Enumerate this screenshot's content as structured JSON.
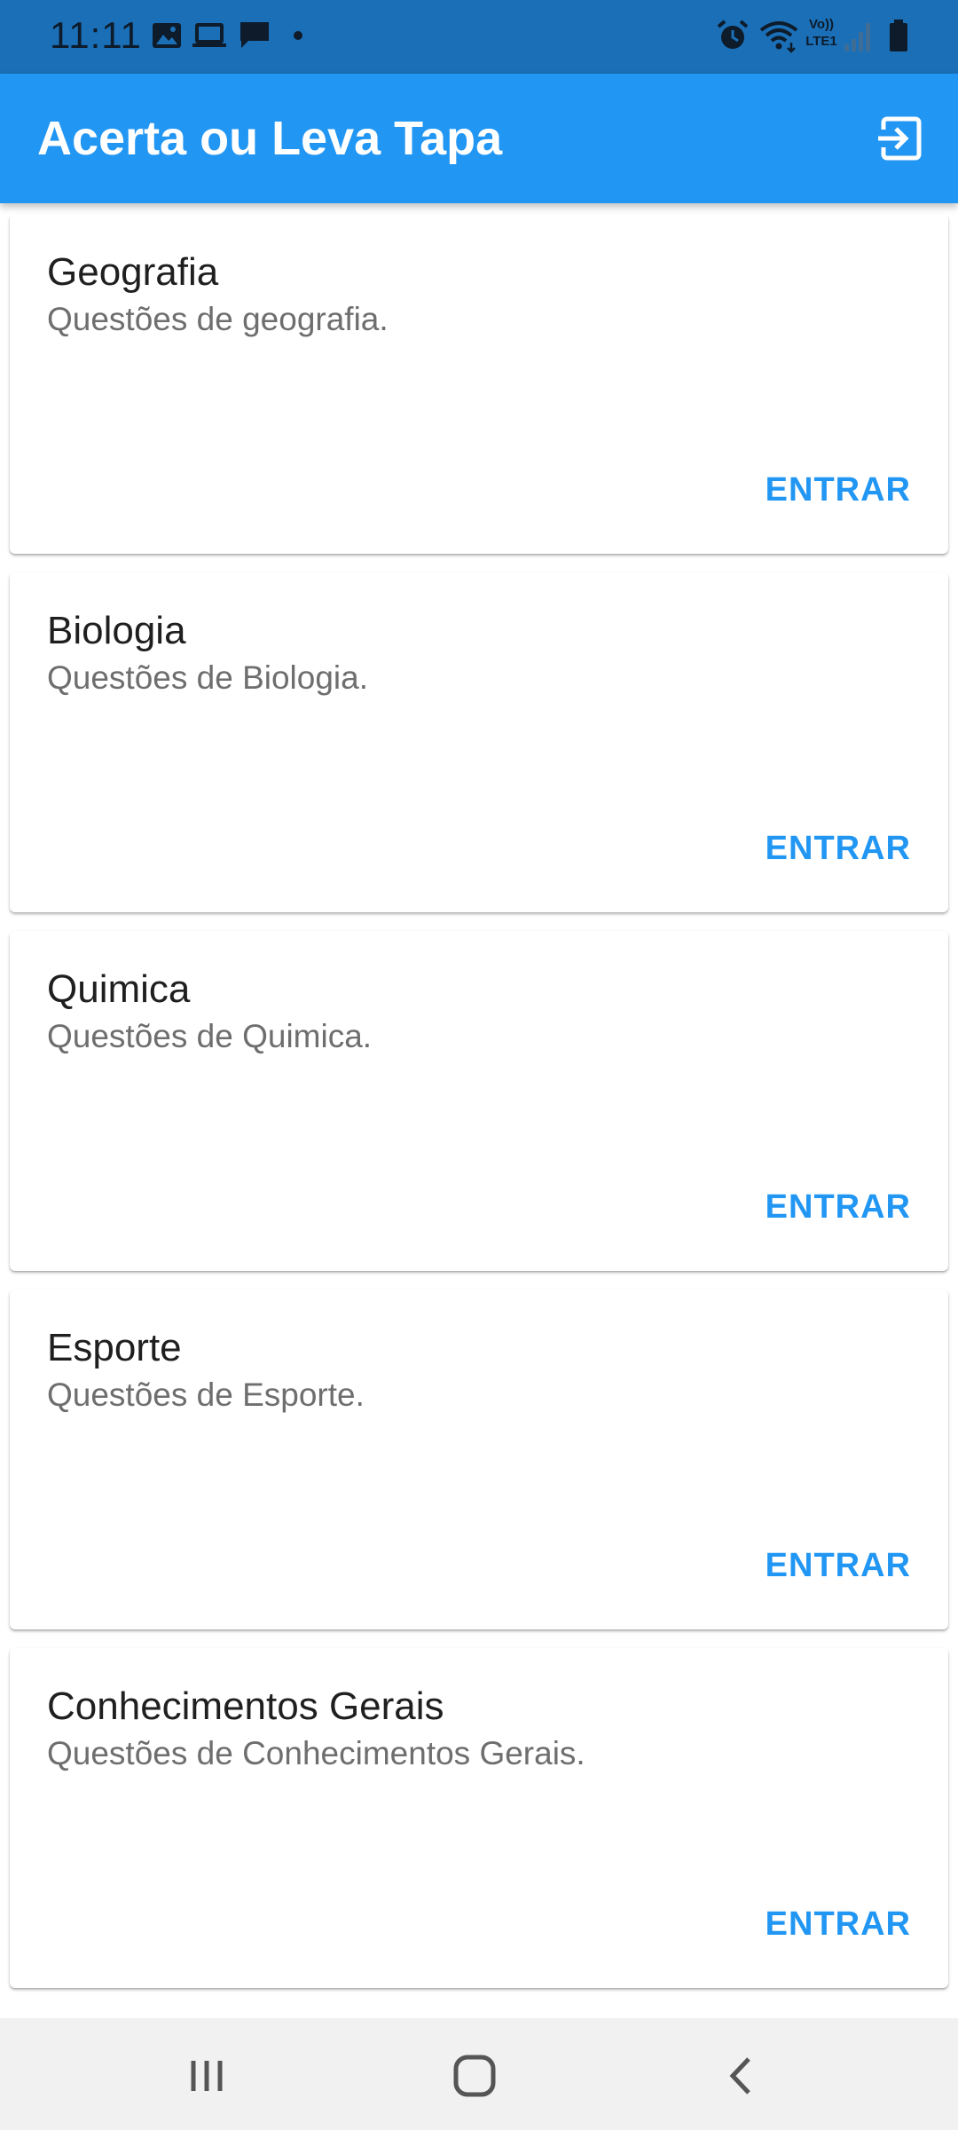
{
  "status_bar": {
    "time": "11:11",
    "left_icons": [
      "image-icon",
      "laptop-icon",
      "chat-icon",
      "dot-icon"
    ],
    "right_icons": [
      "alarm-icon",
      "wifi-icon",
      "volte-lte-icon",
      "signal-icon",
      "battery-icon"
    ],
    "volte_label_top": "Vo))",
    "volte_label_bottom": "LTE1"
  },
  "app_bar": {
    "title": "Acerta ou Leva Tapa",
    "action_icon": "logout-icon"
  },
  "categories": [
    {
      "title": "Geografia",
      "subtitle": "Questões de geografia.",
      "action": "ENTRAR"
    },
    {
      "title": "Biologia",
      "subtitle": "Questões de Biologia.",
      "action": "ENTRAR"
    },
    {
      "title": "Quimica",
      "subtitle": "Questões de Quimica.",
      "action": "ENTRAR"
    },
    {
      "title": "Esporte",
      "subtitle": "Questões de Esporte.",
      "action": "ENTRAR"
    },
    {
      "title": "Conhecimentos Gerais",
      "subtitle": "Questões de Conhecimentos Gerais.",
      "action": "ENTRAR"
    }
  ],
  "nav_bar": {
    "icons": [
      "recent-apps-icon",
      "home-icon",
      "back-icon"
    ]
  },
  "colors": {
    "status_bar": "#1b6fb7",
    "app_bar": "#2196f3",
    "accent": "#2196f3",
    "nav_bar": "#f1f1f1"
  }
}
